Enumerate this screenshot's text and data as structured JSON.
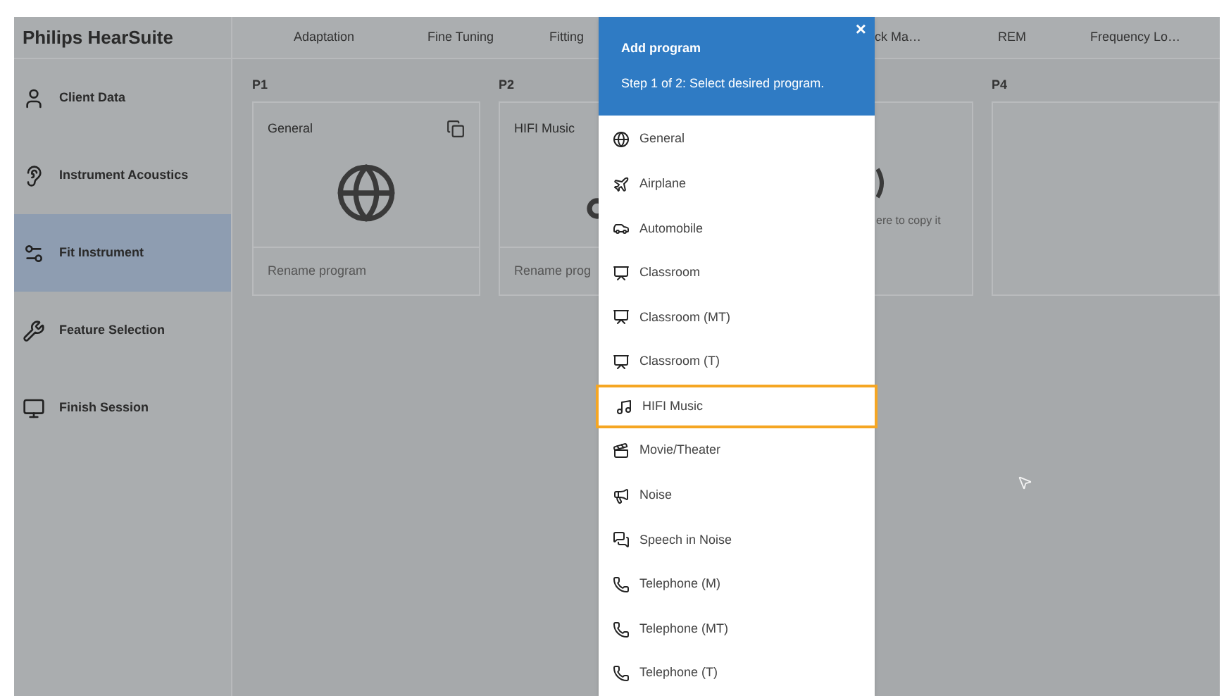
{
  "app_title": "Philips HearSuite",
  "tabs": [
    "Adaptation",
    "Fine Tuning",
    "Fitting",
    "ck Ma…",
    "REM",
    "Frequency Lo…"
  ],
  "sidebar": {
    "items": [
      {
        "label": "Client Data",
        "kind": "client",
        "selected": false
      },
      {
        "label": "Instrument Acoustics",
        "kind": "acoustics",
        "selected": false
      },
      {
        "label": "Fit Instrument",
        "kind": "fit",
        "selected": true
      },
      {
        "label": "Feature Selection",
        "kind": "feature",
        "selected": false
      },
      {
        "label": "Finish Session",
        "kind": "finish",
        "selected": false
      }
    ]
  },
  "programs": [
    {
      "slot": "P1",
      "name": "General",
      "kind": "globe",
      "rename": "Rename program"
    },
    {
      "slot": "P2",
      "name": "HIFI Music",
      "kind": "music",
      "rename": "Rename prog"
    },
    {
      "kind": "empty",
      "hint": "ere to copy it"
    },
    {
      "slot": "P4",
      "kind": "blank"
    }
  ],
  "dialog": {
    "title": "Add program",
    "subtitle": "Step 1 of 2: Select desired program.",
    "close": "×",
    "items": [
      {
        "label": "General",
        "kind": "globe",
        "selected": false
      },
      {
        "label": "Airplane",
        "kind": "plane",
        "selected": false
      },
      {
        "label": "Automobile",
        "kind": "car",
        "selected": false
      },
      {
        "label": "Classroom",
        "kind": "classroom",
        "selected": false
      },
      {
        "label": "Classroom (MT)",
        "kind": "classroom",
        "selected": false
      },
      {
        "label": "Classroom (T)",
        "kind": "classroom",
        "selected": false
      },
      {
        "label": "HIFI Music",
        "kind": "music",
        "selected": true
      },
      {
        "label": "Movie/Theater",
        "kind": "movie",
        "selected": false
      },
      {
        "label": "Noise",
        "kind": "noise",
        "selected": false
      },
      {
        "label": "Speech in Noise",
        "kind": "speech",
        "selected": false
      },
      {
        "label": "Telephone (M)",
        "kind": "phone",
        "selected": false
      },
      {
        "label": "Telephone (MT)",
        "kind": "phone",
        "selected": false
      },
      {
        "label": "Telephone (T)",
        "kind": "phone",
        "selected": false
      }
    ]
  }
}
